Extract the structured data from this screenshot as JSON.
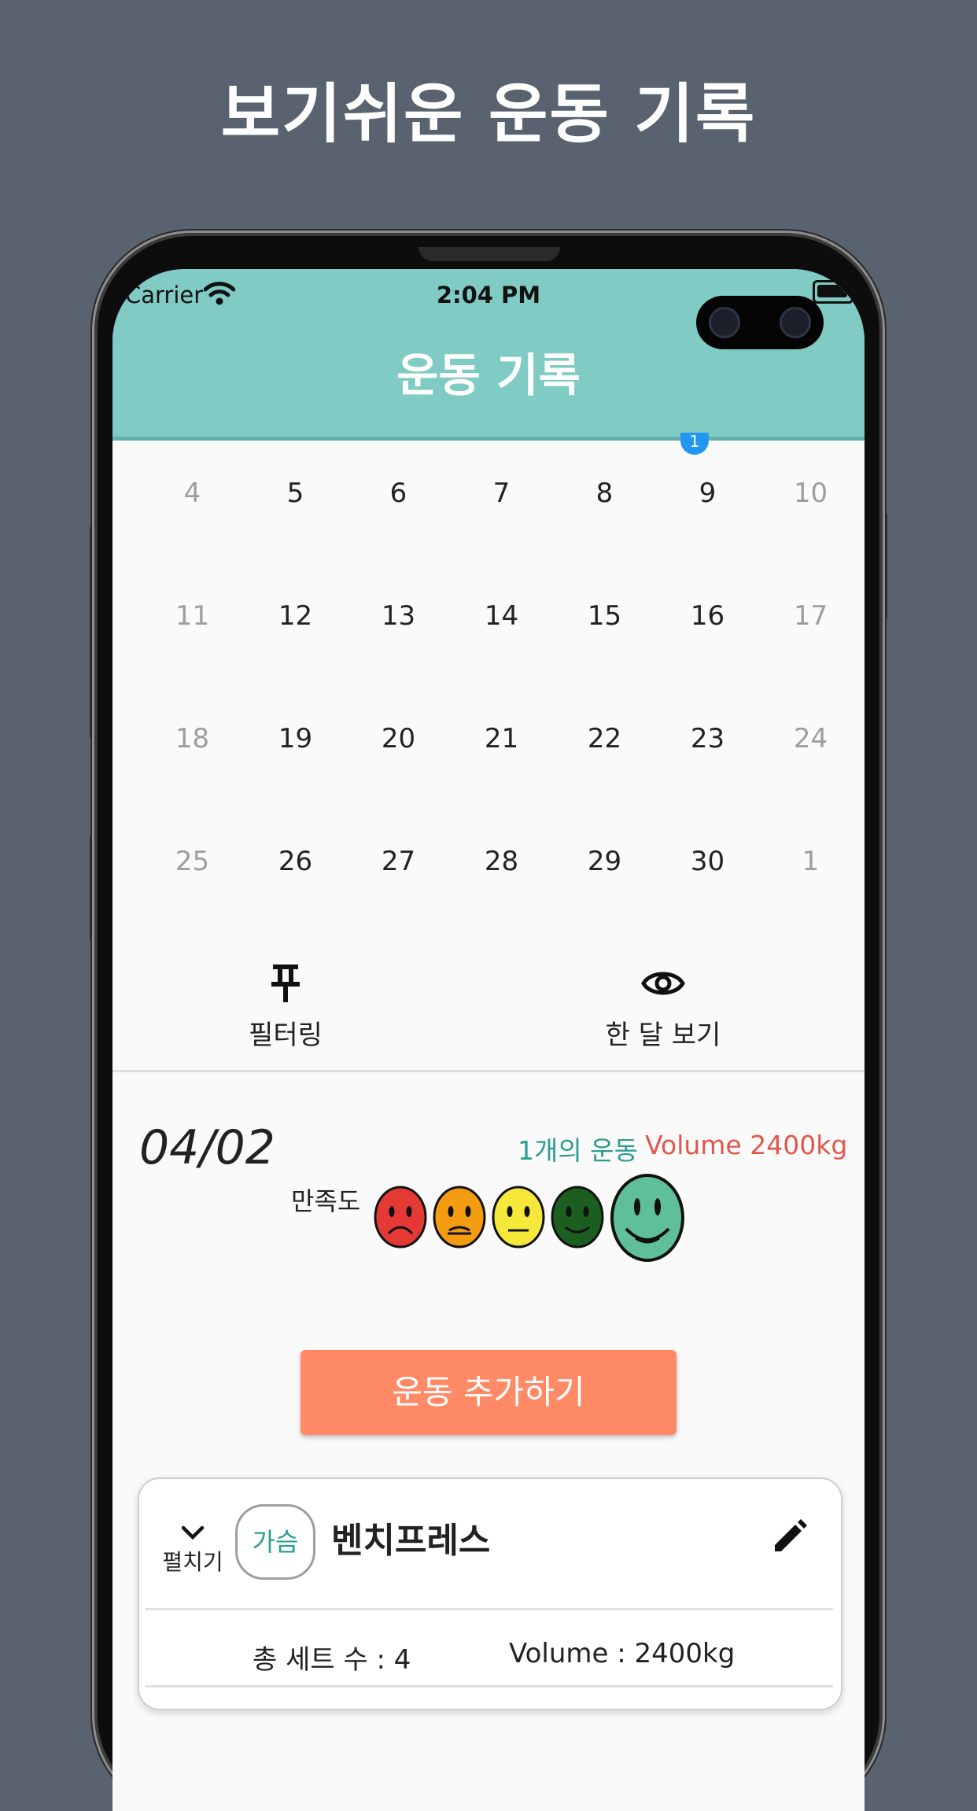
{
  "promo": {
    "title": "보기쉬운 운동 기록"
  },
  "status_bar": {
    "carrier": "Carrier",
    "time": "2:04 PM"
  },
  "app_bar": {
    "title": "운동 기록"
  },
  "calendar": {
    "badge": "1",
    "rows": [
      [
        {
          "d": "4",
          "m": true
        },
        {
          "d": "5"
        },
        {
          "d": "6"
        },
        {
          "d": "7"
        },
        {
          "d": "8"
        },
        {
          "d": "9"
        },
        {
          "d": "10",
          "m": true
        }
      ],
      [
        {
          "d": "11",
          "m": true
        },
        {
          "d": "12"
        },
        {
          "d": "13"
        },
        {
          "d": "14"
        },
        {
          "d": "15"
        },
        {
          "d": "16"
        },
        {
          "d": "17",
          "m": true
        }
      ],
      [
        {
          "d": "18",
          "m": true
        },
        {
          "d": "19"
        },
        {
          "d": "20"
        },
        {
          "d": "21"
        },
        {
          "d": "22"
        },
        {
          "d": "23"
        },
        {
          "d": "24",
          "m": true
        }
      ],
      [
        {
          "d": "25",
          "m": true
        },
        {
          "d": "26"
        },
        {
          "d": "27"
        },
        {
          "d": "28"
        },
        {
          "d": "29"
        },
        {
          "d": "30"
        },
        {
          "d": "1",
          "m": true
        }
      ]
    ]
  },
  "actions": {
    "filter_label": "필터링",
    "month_view_label": "한 달 보기"
  },
  "day_summary": {
    "date": "04/02",
    "exercise_count": "1개의 운동",
    "volume": "Volume 2400kg"
  },
  "satisfaction": {
    "label": "만족도",
    "colors": [
      "#e53935",
      "#f39c12",
      "#f5e83a",
      "#1b5e20",
      "#5fbf98"
    ],
    "selected_index": 4
  },
  "add_button": {
    "label": "운동 추가하기"
  },
  "exercise_card": {
    "expand_label": "펼치기",
    "category": "가슴",
    "name": "벤치프레스",
    "sets": "총 세트 수 : 4",
    "volume": "Volume : 2400kg"
  }
}
